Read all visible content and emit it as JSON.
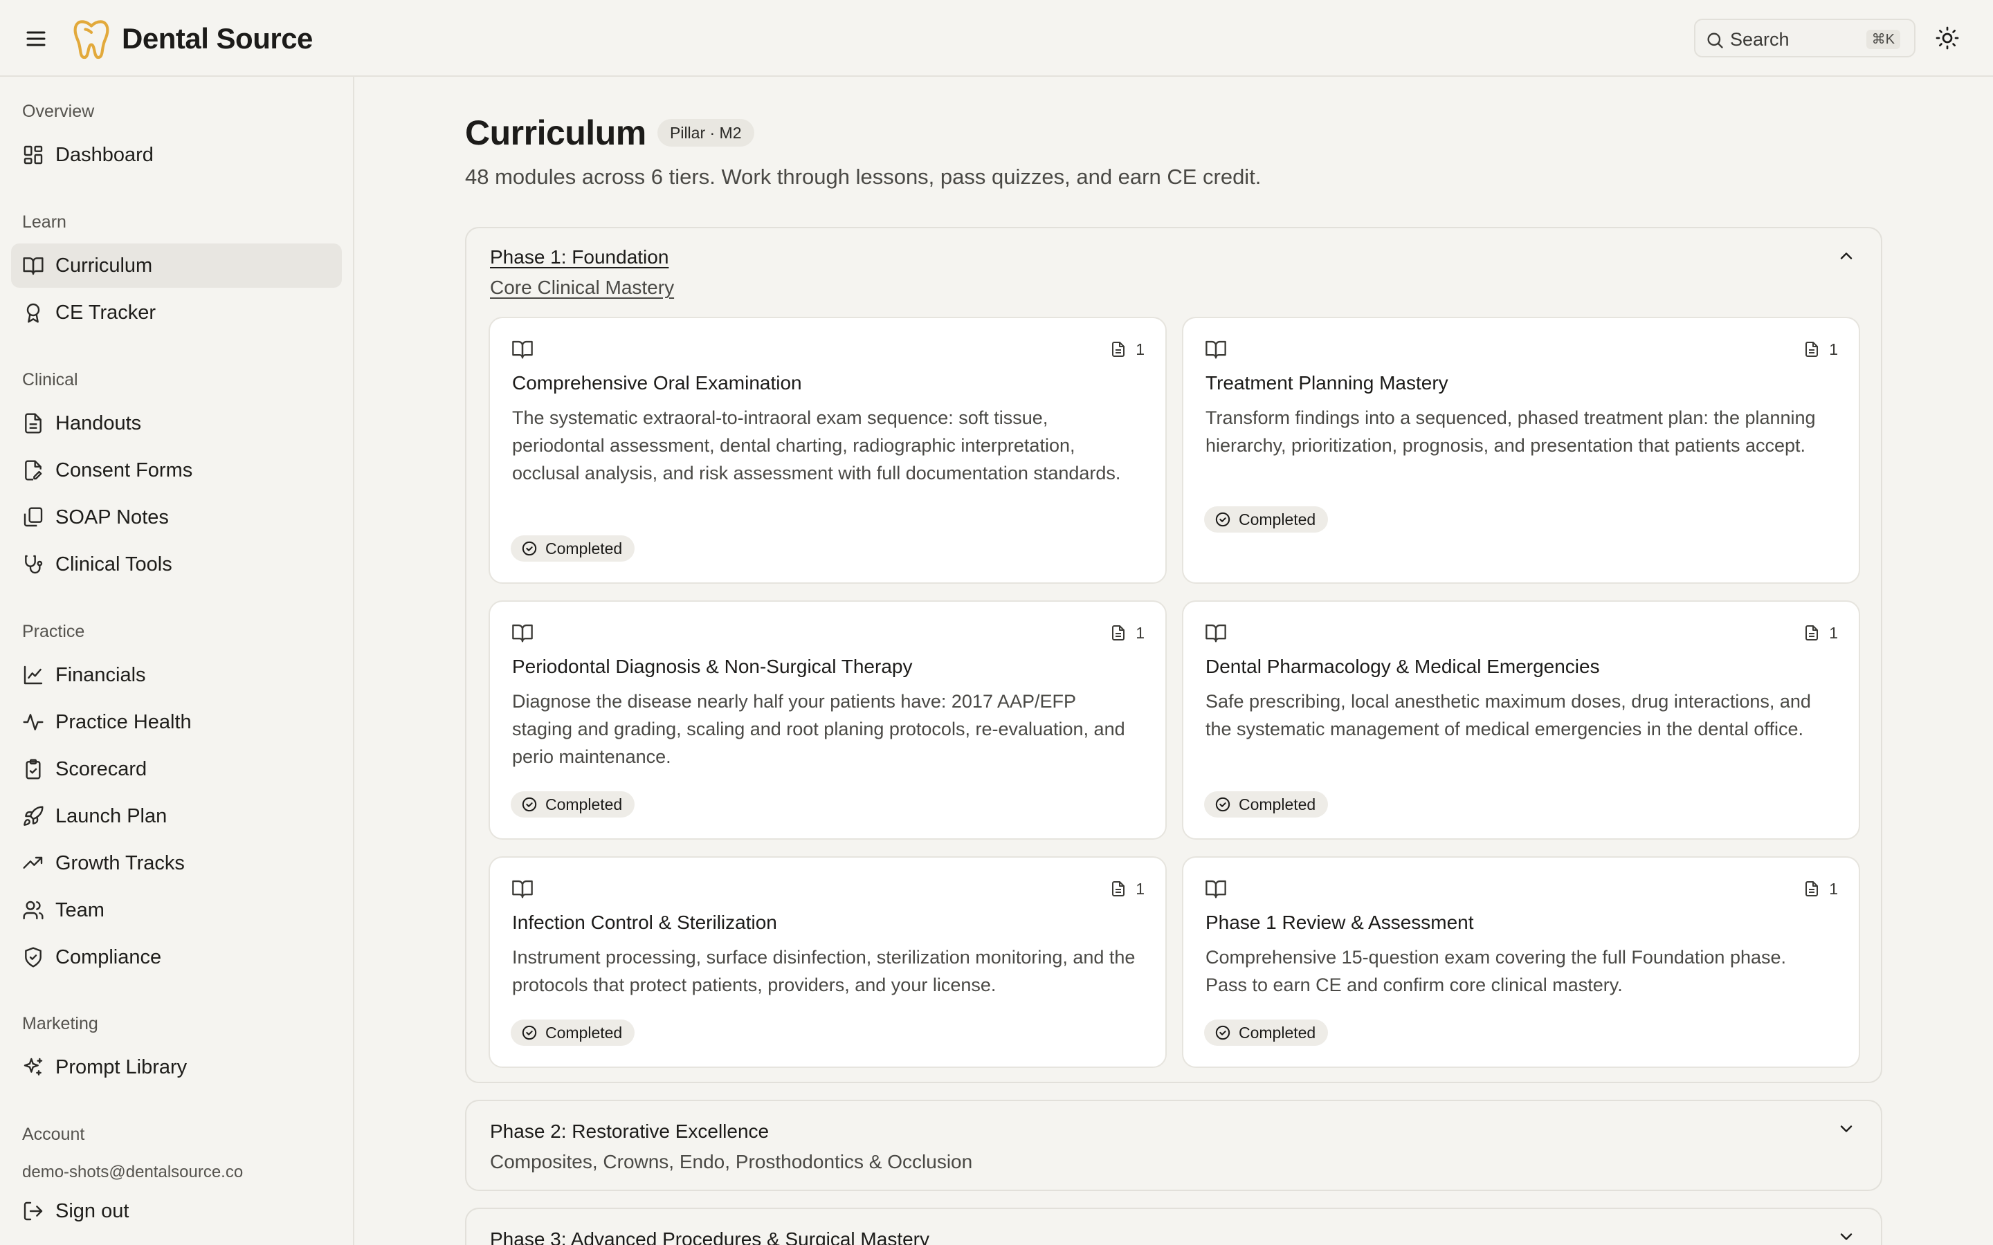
{
  "header": {
    "brand": "Dental Source",
    "search_placeholder": "Search",
    "search_shortcut": "⌘K",
    "accent_color": "#e2a93b"
  },
  "sidebar": {
    "sections": [
      {
        "label": "Overview",
        "items": [
          {
            "label": "Dashboard",
            "icon": "layout-dashboard-icon"
          }
        ]
      },
      {
        "label": "Learn",
        "items": [
          {
            "label": "Curriculum",
            "icon": "book-open-icon",
            "active": true
          },
          {
            "label": "CE Tracker",
            "icon": "award-icon"
          }
        ]
      },
      {
        "label": "Clinical",
        "items": [
          {
            "label": "Handouts",
            "icon": "file-text-icon"
          },
          {
            "label": "Consent Forms",
            "icon": "file-pen-icon"
          },
          {
            "label": "SOAP Notes",
            "icon": "clipboard-copy-icon"
          },
          {
            "label": "Clinical Tools",
            "icon": "stethoscope-icon"
          }
        ]
      },
      {
        "label": "Practice",
        "items": [
          {
            "label": "Financials",
            "icon": "line-chart-icon"
          },
          {
            "label": "Practice Health",
            "icon": "activity-icon"
          },
          {
            "label": "Scorecard",
            "icon": "clipboard-check-icon"
          },
          {
            "label": "Launch Plan",
            "icon": "rocket-icon"
          },
          {
            "label": "Growth Tracks",
            "icon": "trending-up-icon"
          },
          {
            "label": "Team",
            "icon": "users-icon"
          },
          {
            "label": "Compliance",
            "icon": "shield-check-icon"
          }
        ]
      },
      {
        "label": "Marketing",
        "items": [
          {
            "label": "Prompt Library",
            "icon": "sparkles-icon"
          }
        ]
      }
    ],
    "account": {
      "label": "Account",
      "email": "demo-shots@dentalsource.co",
      "sign_out": "Sign out"
    }
  },
  "main": {
    "title": "Curriculum",
    "badge": "Pillar · M2",
    "subtitle": "48 modules across 6 tiers. Work through lessons, pass quizzes, and earn CE credit.",
    "phases": [
      {
        "title": "Phase 1: Foundation",
        "subtitle": "Core Clinical Mastery",
        "expanded": true,
        "modules": [
          {
            "title": "Comprehensive Oral Examination",
            "description": "The systematic extraoral-to-intraoral exam sequence: soft tissue, periodontal assessment, dental charting, radiographic interpretation, occlusal analysis, and risk assessment with full documentation standards.",
            "lessons": "1",
            "status": "Completed"
          },
          {
            "title": "Treatment Planning Mastery",
            "description": "Transform findings into a sequenced, phased treatment plan: the planning hierarchy, prioritization, prognosis, and presentation that patients accept.",
            "lessons": "1",
            "status": "Completed"
          },
          {
            "title": "Periodontal Diagnosis & Non-Surgical Therapy",
            "description": "Diagnose the disease nearly half your patients have: 2017 AAP/EFP staging and grading, scaling and root planing protocols, re-evaluation, and perio maintenance.",
            "lessons": "1",
            "status": "Completed"
          },
          {
            "title": "Dental Pharmacology & Medical Emergencies",
            "description": "Safe prescribing, local anesthetic maximum doses, drug interactions, and the systematic management of medical emergencies in the dental office.",
            "lessons": "1",
            "status": "Completed"
          },
          {
            "title": "Infection Control & Sterilization",
            "description": "Instrument processing, surface disinfection, sterilization monitoring, and the protocols that protect patients, providers, and your license.",
            "lessons": "1",
            "status": "Completed"
          },
          {
            "title": "Phase 1 Review & Assessment",
            "description": "Comprehensive 15-question exam covering the full Foundation phase. Pass to earn CE and confirm core clinical mastery.",
            "lessons": "1",
            "status": "Completed"
          }
        ]
      },
      {
        "title": "Phase 2: Restorative Excellence",
        "subtitle": "Composites, Crowns, Endo, Prosthodontics & Occlusion",
        "expanded": false
      },
      {
        "title": "Phase 3: Advanced Procedures & Surgical Mastery",
        "subtitle": "",
        "expanded": false
      }
    ]
  }
}
